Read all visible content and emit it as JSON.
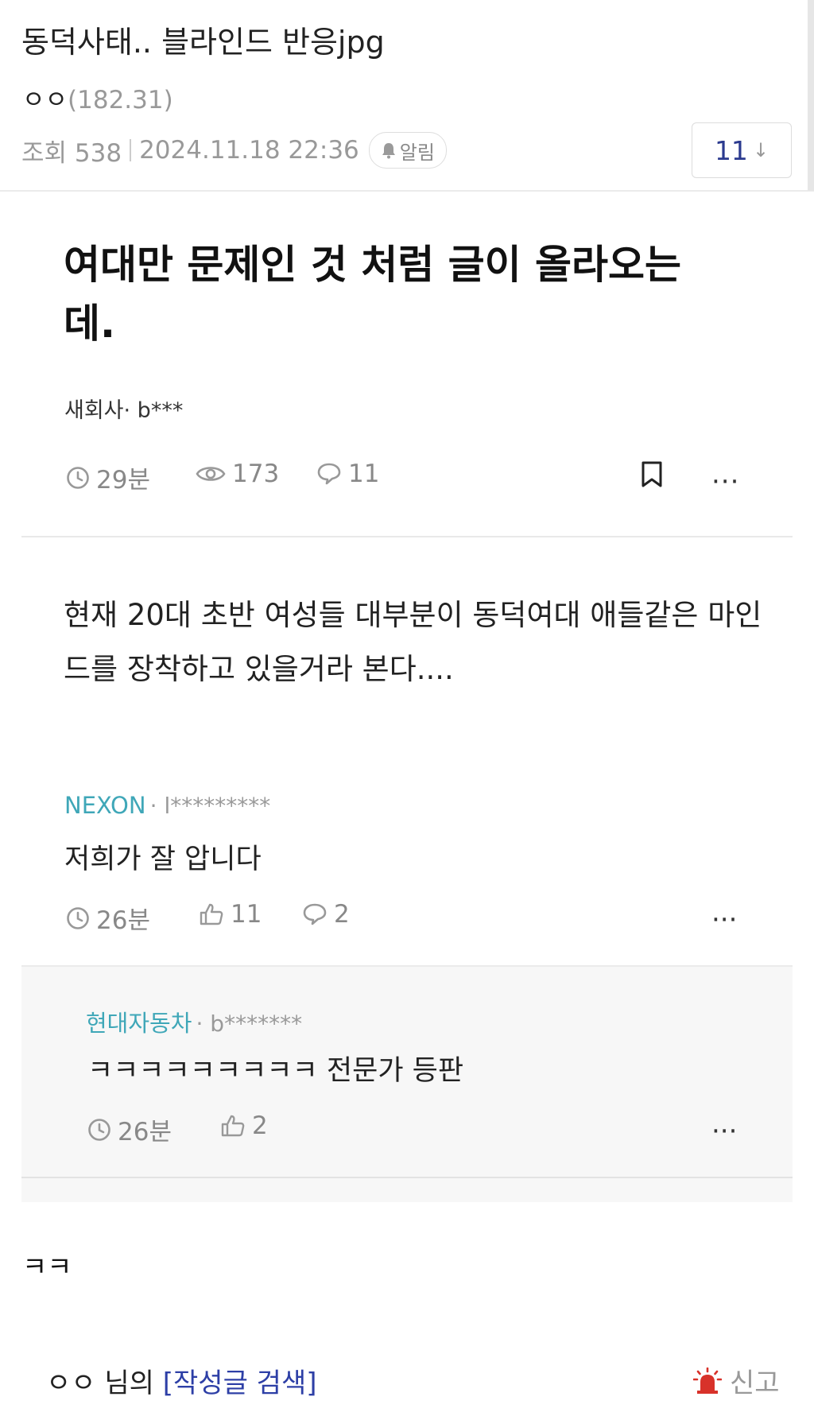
{
  "post": {
    "title": "동덕사태.. 블라인드 반응jpg",
    "author": "ㅇㅇ",
    "ip": "(182.31)",
    "views_label": "조회 538",
    "datetime": "2024.11.18 22:36",
    "alarm_label": "알림",
    "comment_count": "11",
    "comment_count_arrow": "↓",
    "caption": "ㅋㅋ"
  },
  "blind": {
    "title": "여대만 문제인 것 처럼 글이 올라오는데.",
    "writer": "새회사· b***",
    "stats": {
      "time": "29분",
      "views": "173",
      "comments": "11"
    },
    "more": "···",
    "body": "현재 20대 초반 여성들 대부분이 동덕여대 애들같은 마인드를 장착하고 있을거라 본다....",
    "comments": [
      {
        "company": "NEXON",
        "user": "· l*********",
        "text": "저희가 잘 압니다",
        "time": "26분",
        "likes": "11",
        "replies": "2"
      }
    ],
    "replies": [
      {
        "company": "현대자동차",
        "user": "· b*******",
        "text": "ㅋㅋㅋㅋㅋㅋㅋㅋㅋ 전문가 등판",
        "time": "26분",
        "likes": "2"
      }
    ]
  },
  "footer": {
    "owner": "ㅇㅇ 님의",
    "search_link": "[작성글 검색]",
    "report_label": "신고"
  },
  "icons": {
    "alarm": "bell-icon",
    "clock": "clock-icon",
    "eye": "eye-icon",
    "comment": "speech-bubble-icon",
    "like": "thumbs-up-icon",
    "bookmark": "bookmark-icon",
    "report": "siren-icon"
  },
  "colors": {
    "company": "#3fa7b8",
    "link": "#2d3fa6",
    "count": "#2b3a8f",
    "siren": "#d8322a",
    "muted": "#999999"
  }
}
